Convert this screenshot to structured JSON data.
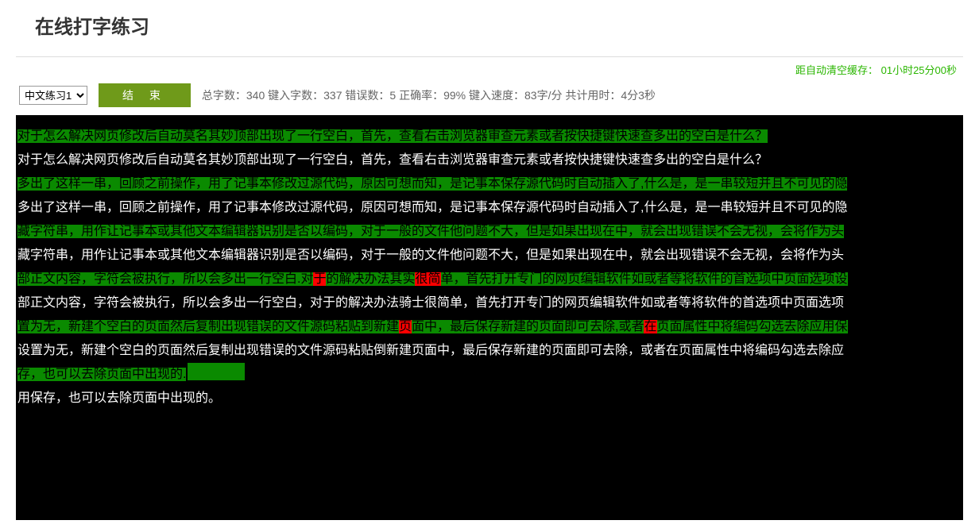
{
  "header": {
    "title": "在线打字练习"
  },
  "clear_cache": {
    "label": "距自动清空缓存：",
    "time": "01小时25分00秒"
  },
  "controls": {
    "lesson_selected": "中文练习1",
    "end_label": "结 束"
  },
  "stats": {
    "total_label": "总字数：",
    "total": "340",
    "typed_label": "键入字数：",
    "typed": "337",
    "errors_label": "错误数：",
    "errors": "5",
    "accuracy_label": "正确率：",
    "accuracy": "99%",
    "speed_label": "键入速度：",
    "speed": "83字/分",
    "elapsed_label": "共计用时：",
    "elapsed": "4分3秒"
  },
  "lines": [
    {
      "ref_segments": [
        {
          "t": "对于怎么解决网页修改后自动莫名其妙顶部出现了一行空白，首先，查看右击浏览器审查元素或者按快捷键快速查多出的空白是什么？",
          "cls": "ok"
        }
      ],
      "typed": "对于怎么解决网页修改后自动莫名其妙顶部出现了一行空白，首先，查看右击浏览器审查元素或者按快捷键快速查多出的空白是什么？"
    },
    {
      "ref_segments": [
        {
          "t": "多出了这样一串，回顾之前操作，用了记事本修改过源代码，原因可想而知，是记事本保存源代码时自动插入了,什么是，是一串较短并且不可见的隐",
          "cls": "ok"
        }
      ],
      "typed": "多出了这样一串，回顾之前操作，用了记事本修改过源代码，原因可想而知，是记事本保存源代码时自动插入了,什么是，是一串较短并且不可见的隐"
    },
    {
      "ref_segments": [
        {
          "t": "藏字符串，用作让记事本或其他文本编辑器识别是否以编码，对于一般的文件他问题不大，但是如果出现在中，就会出现错误不会无视，会将作为头",
          "cls": "ok"
        }
      ],
      "typed": "藏字符串，用作让记事本或其他文本编辑器识别是否以编码，对于一般的文件他问题不大，但是如果出现在中，就会出现错误不会无视，会将作为头"
    },
    {
      "ref_segments": [
        {
          "t": "部正文内容，字符会被执行，所以会多出一行空白.对",
          "cls": "ok"
        },
        {
          "t": "于",
          "cls": "err"
        },
        {
          "t": "的解决办法其实",
          "cls": "ok"
        },
        {
          "t": "很简",
          "cls": "err"
        },
        {
          "t": "单，首先打开专门的网页编辑软件如或者等将软件的首选项中页面选项设",
          "cls": "ok"
        }
      ],
      "typed": "部正文内容，字符会被执行，所以会多出一行空白，对于的解决办法骑士很简单，首先打开专门的网页编辑软件如或者等将软件的首选项中页面选项"
    },
    {
      "ref_segments": [
        {
          "t": "置为无，新建个空白的页面然后复制出现错误的文件源码粘贴到新建",
          "cls": "ok"
        },
        {
          "t": "页",
          "cls": "err"
        },
        {
          "t": "面中，最后保存新建的页面即可去除,或者",
          "cls": "ok"
        },
        {
          "t": "在",
          "cls": "err"
        },
        {
          "t": "页面属性中将编码勾选去除应用保",
          "cls": "ok"
        }
      ],
      "typed": "设置为无，新建个空白的页面然后复制出现错误的文件源码粘贴倒新建页面中，最后保存新建的页面即可去除，或者在页面属性中将编码勾选去除应"
    },
    {
      "ref_segments": [
        {
          "t": "存，也可以去除页面中出现的.",
          "cls": "ok"
        }
      ],
      "typed": "用保存，也可以去除页面中出现的。",
      "show_cursor_on_ref": true
    }
  ]
}
